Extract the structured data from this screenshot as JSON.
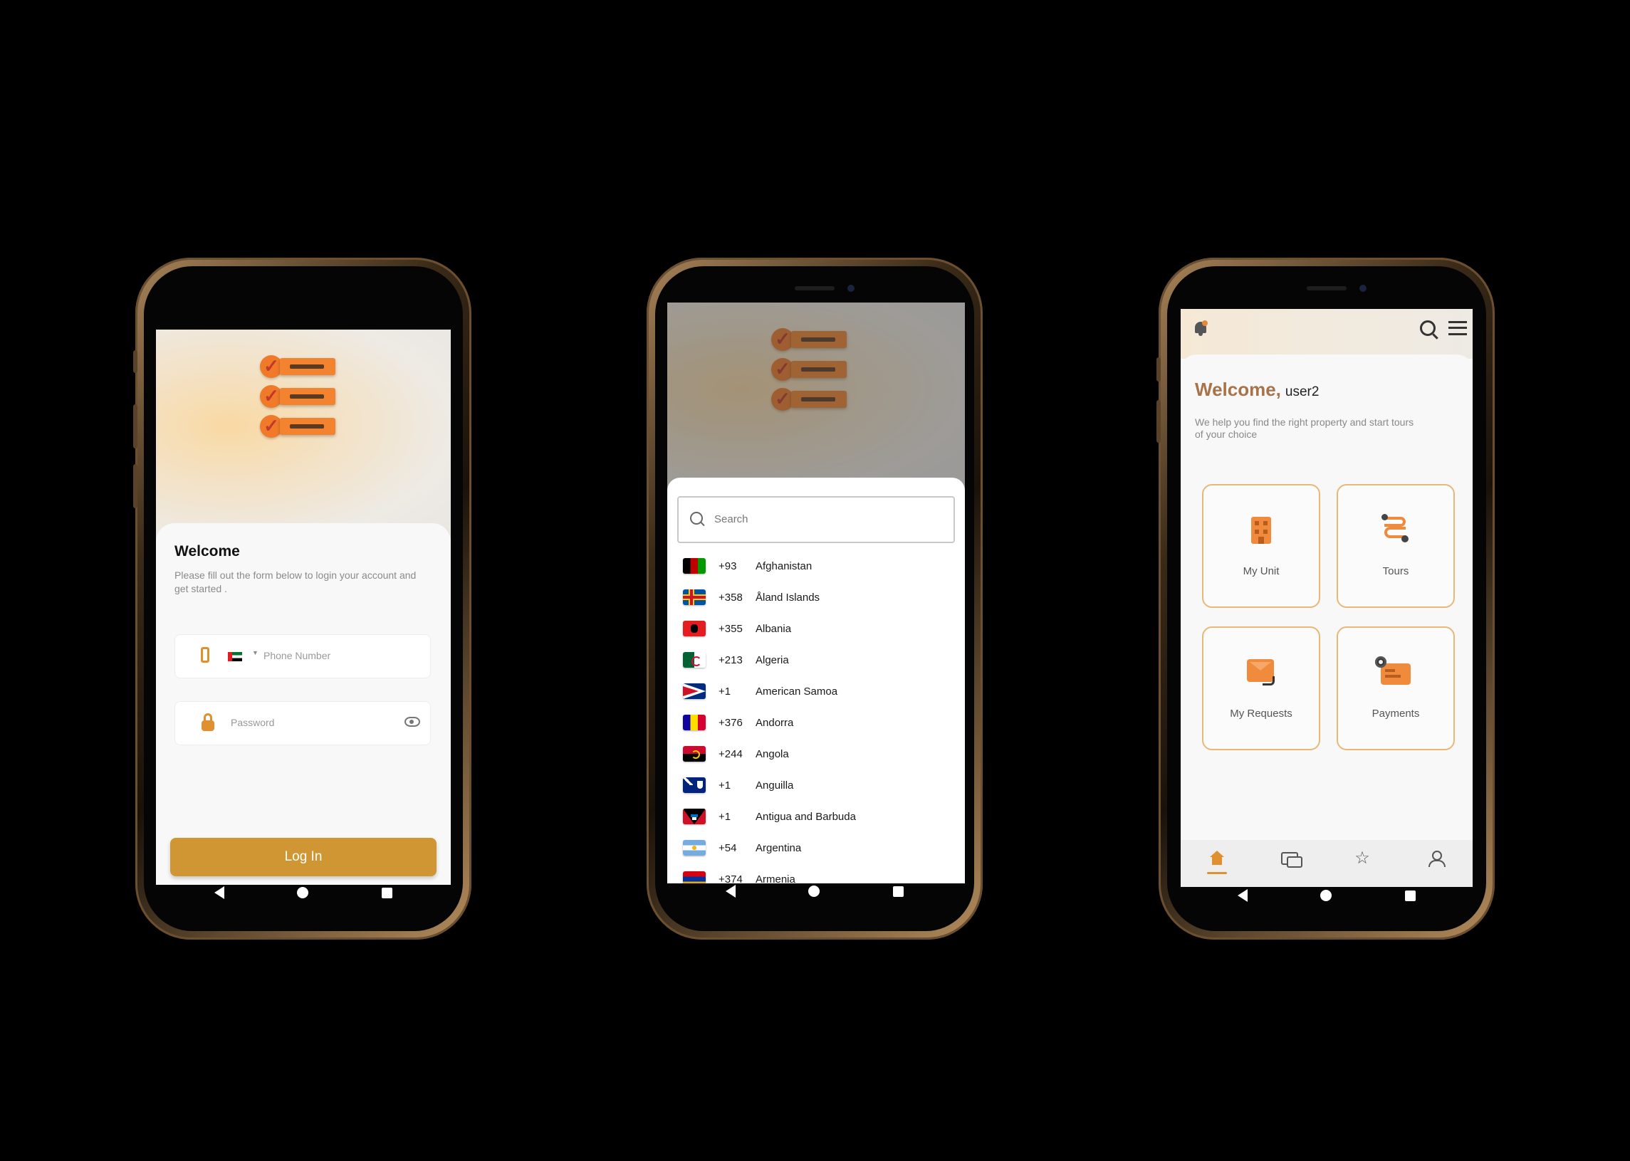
{
  "login": {
    "welcome_title": "Welcome",
    "welcome_subtitle": "Please fill out the form below to login your account and get  started .",
    "phone_placeholder": "Phone Number",
    "password_placeholder": "Password",
    "login_button": "Log In"
  },
  "country_picker": {
    "search_placeholder": "Search",
    "countries": [
      {
        "code": "+93",
        "name": "Afghanistan"
      },
      {
        "code": "+358",
        "name": "Åland Islands"
      },
      {
        "code": "+355",
        "name": "Albania"
      },
      {
        "code": "+213",
        "name": "Algeria"
      },
      {
        "code": "+1",
        "name": "American Samoa"
      },
      {
        "code": "+376",
        "name": "Andorra"
      },
      {
        "code": "+244",
        "name": "Angola"
      },
      {
        "code": "+1",
        "name": "Anguilla"
      },
      {
        "code": "+1",
        "name": "Antigua and Barbuda"
      },
      {
        "code": "+54",
        "name": "Argentina"
      },
      {
        "code": "+374",
        "name": "Armenia"
      }
    ]
  },
  "home": {
    "welcome_prefix": "Welcome,",
    "username": "user2",
    "subtitle": "We help you find the right property and start tours of your choice",
    "tiles": [
      {
        "label": "My Unit",
        "icon": "building-icon"
      },
      {
        "label": "Tours",
        "icon": "route-icon"
      },
      {
        "label": "My Requests",
        "icon": "requests-icon"
      },
      {
        "label": "Payments",
        "icon": "payments-icon"
      }
    ],
    "tabs": [
      "home-tab",
      "chat-tab",
      "favorites-tab",
      "profile-tab"
    ]
  },
  "colors": {
    "accent": "#d09633",
    "tile_border": "#e7b878",
    "icon_orange": "#f08a3c"
  }
}
